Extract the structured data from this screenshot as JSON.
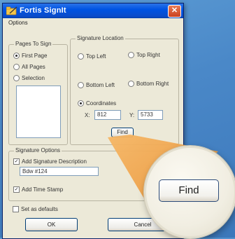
{
  "window": {
    "title": "Fortis SignIt",
    "close_glyph": "✕"
  },
  "menu": {
    "options": "Options"
  },
  "pages_to_sign": {
    "legend": "Pages To Sign",
    "first_page": "First Page",
    "all_pages": "All Pages",
    "selection": "Selection",
    "selected": "first_page"
  },
  "signature_location": {
    "legend": "Signature Location",
    "top_left": "Top Left",
    "top_right": "Top Right",
    "bottom_left": "Bottom Left",
    "bottom_right": "Bottom Right",
    "coordinates": "Coordinates",
    "selected": "coordinates",
    "x_label": "X:",
    "x_value": "812",
    "y_label": "Y:",
    "y_value": "5733",
    "find_button": "Find"
  },
  "signature_options": {
    "legend": "Signature Options",
    "add_description_label": "Add Signature Description",
    "add_description_checked": true,
    "description_value": "Bdw #124",
    "add_timestamp_label": "Add Time Stamp",
    "add_timestamp_checked": true
  },
  "defaults": {
    "label": "Set as defaults",
    "checked": false
  },
  "buttons": {
    "ok": "OK",
    "cancel": "Cancel"
  },
  "magnifier": {
    "label": "Find"
  },
  "colors": {
    "titlebar": "#0054E3",
    "dialog_bg": "#ECE9D8",
    "background": "#4A88C8",
    "beam": "#F0A24A"
  },
  "icons": {
    "app": "pen-folder-icon",
    "close": "close-icon"
  }
}
